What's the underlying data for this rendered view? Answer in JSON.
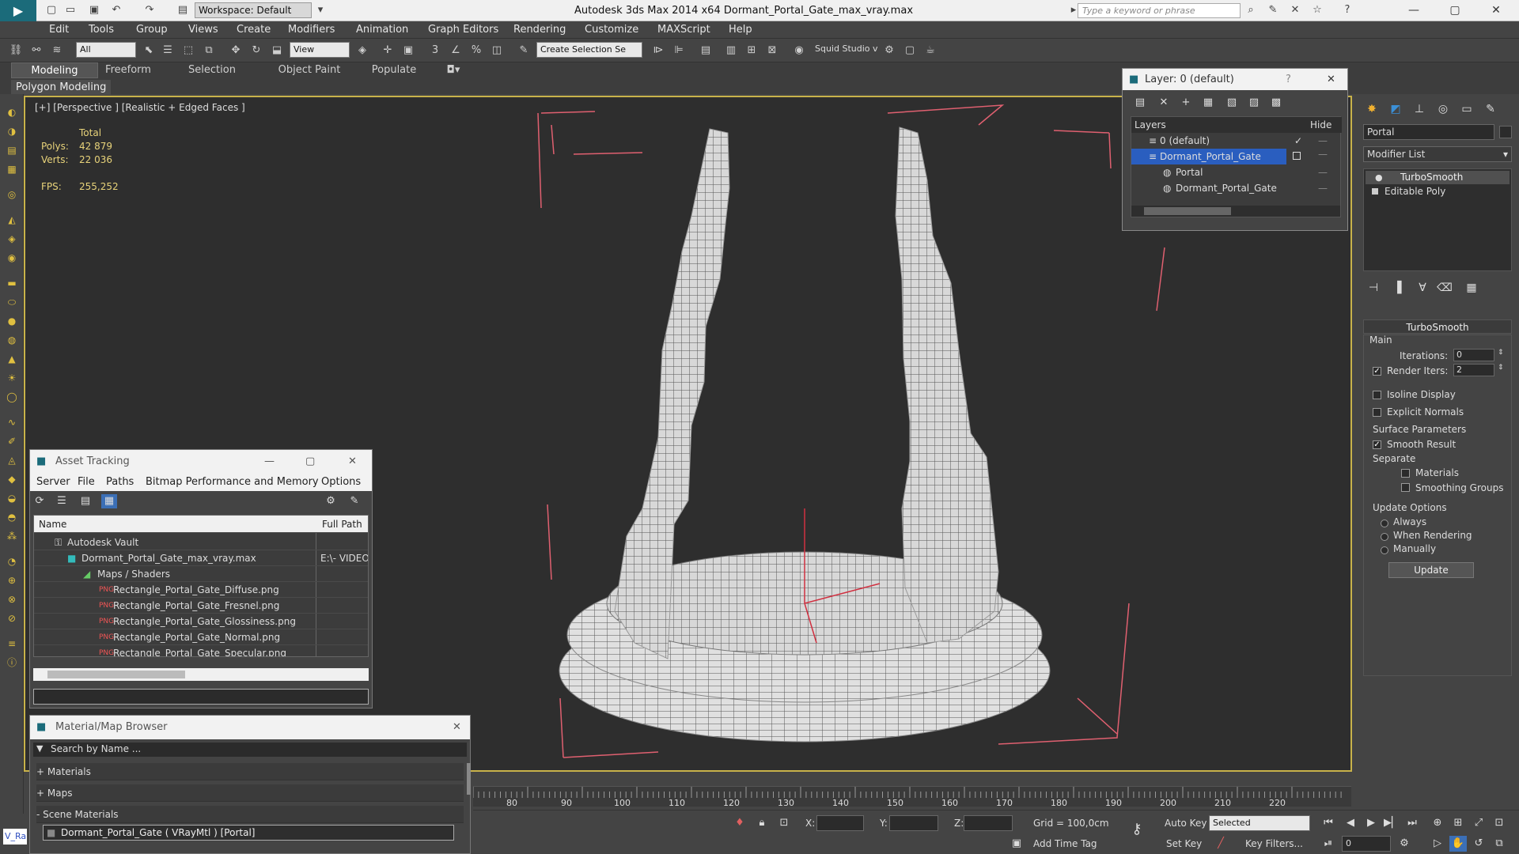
{
  "titlebar": {
    "workspace": "Workspace: Default",
    "title": "Autodesk 3ds Max  2014 x64     Dormant_Portal_Gate_max_vray.max",
    "search_placeholder": "Type a keyword or phrase"
  },
  "menu": [
    "Edit",
    "Tools",
    "Group",
    "Views",
    "Create",
    "Modifiers",
    "Animation",
    "Graph Editors",
    "Rendering",
    "Customize",
    "MAXScript",
    "Help"
  ],
  "toolbar": {
    "filter": "All",
    "ref_coord": "View",
    "selection_set": "Create Selection Se",
    "squid": "Squid Studio v"
  },
  "ribbon": {
    "tabs": [
      "Modeling",
      "Freeform",
      "Selection",
      "Object Paint",
      "Populate"
    ],
    "panel": "Polygon Modeling"
  },
  "viewport": {
    "label": "[+] [Perspective ] [Realistic + Edged Faces ]",
    "stats": {
      "total_label": "Total",
      "polys_label": "Polys:",
      "polys": "42 879",
      "verts_label": "Verts:",
      "verts": "22 036",
      "fps_label": "FPS:",
      "fps": "255,252"
    }
  },
  "layer_dialog": {
    "title": "Layer: 0 (default)",
    "help": "?",
    "col_layers": "Layers",
    "col_hide": "Hide",
    "rows": [
      "0 (default)",
      "Dormant_Portal_Gate",
      "Portal",
      "Dormant_Portal_Gate"
    ]
  },
  "command_panel": {
    "object_name": "Portal",
    "modifier_list": "Modifier List",
    "stack": [
      "TurboSmooth",
      "Editable Poly"
    ],
    "rollout": "TurboSmooth",
    "main": "Main",
    "iterations_label": "Iterations:",
    "iterations": "0",
    "render_iters_label": "Render Iters:",
    "render_iters": "2",
    "isoline": "Isoline Display",
    "explicit_normals": "Explicit Normals",
    "surface_params": "Surface Parameters",
    "smooth_result": "Smooth Result",
    "separate": "Separate",
    "materials": "Materials",
    "smoothing_groups": "Smoothing Groups",
    "update_options": "Update Options",
    "always": "Always",
    "when_rendering": "When Rendering",
    "manually": "Manually",
    "update_btn": "Update"
  },
  "asset_tracking": {
    "title": "Asset Tracking",
    "menu": [
      "Server",
      "File",
      "Paths",
      "Bitmap Performance and Memory",
      "Options"
    ],
    "col_name": "Name",
    "col_path": "Full Path",
    "rows": [
      {
        "name": "Autodesk Vault",
        "path": ""
      },
      {
        "name": "Dormant_Portal_Gate_max_vray.max",
        "path": "E:\\- VIDEO"
      },
      {
        "name": "Maps / Shaders",
        "path": ""
      },
      {
        "name": "Rectangle_Portal_Gate_Diffuse.png",
        "path": ""
      },
      {
        "name": "Rectangle_Portal_Gate_Fresnel.png",
        "path": ""
      },
      {
        "name": "Rectangle_Portal_Gate_Glossiness.png",
        "path": ""
      },
      {
        "name": "Rectangle_Portal_Gate_Normal.png",
        "path": ""
      },
      {
        "name": "Rectangle_Portal_Gate_Specular.png",
        "path": ""
      }
    ]
  },
  "material_browser": {
    "title": "Material/Map Browser",
    "search_placeholder": "Search by Name ...",
    "sections": [
      "+ Materials",
      "+ Maps",
      "- Scene Materials"
    ],
    "scene_material": "Dormant_Portal_Gate  ( VRayMtl ) [Portal]"
  },
  "timeline": {
    "ticks": [
      "80",
      "90",
      "100",
      "110",
      "120",
      "130",
      "140",
      "150",
      "160",
      "170",
      "180",
      "190",
      "200",
      "210",
      "220"
    ]
  },
  "statusbar": {
    "x_label": "X:",
    "y_label": "Y:",
    "z_label": "Z:",
    "grid": "Grid = 100,0cm",
    "add_time_tag": "Add Time Tag",
    "auto_key": "Auto Key",
    "selected": "Selected",
    "set_key": "Set Key",
    "key_filters": "Key Filters...",
    "frame": "0",
    "maxscript": "V_Ra"
  }
}
